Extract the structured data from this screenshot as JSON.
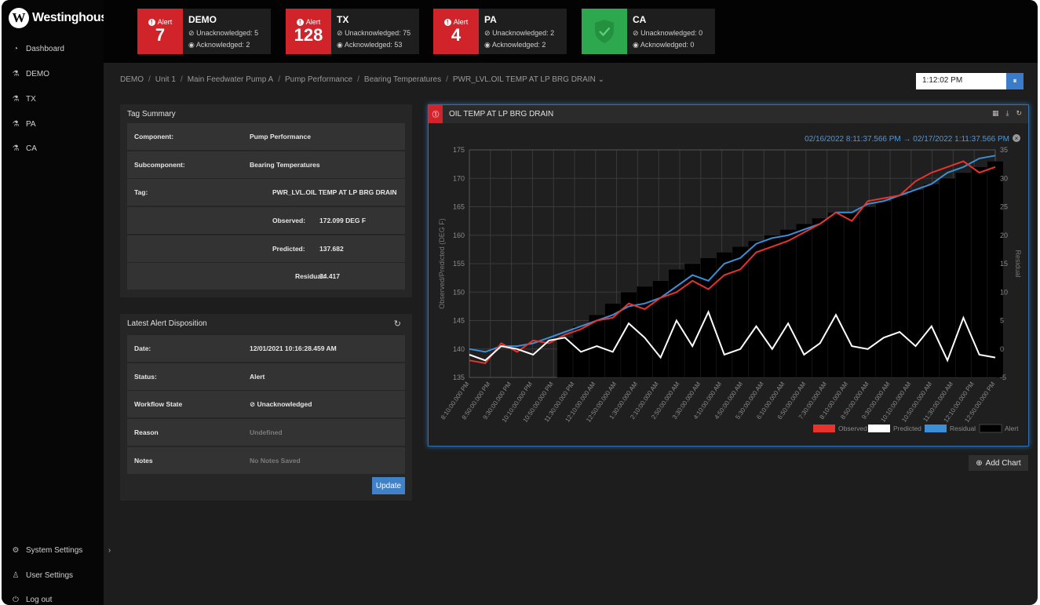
{
  "app": {
    "logo_text": "Westinghouse"
  },
  "sidebar": {
    "items": [
      {
        "label": "Dashboard",
        "icon": "gauge-icon"
      },
      {
        "label": "DEMO",
        "icon": "flask-icon"
      },
      {
        "label": "TX",
        "icon": "flask-icon"
      },
      {
        "label": "PA",
        "icon": "flask-icon"
      },
      {
        "label": "CA",
        "icon": "flask-icon"
      }
    ],
    "bottom": [
      {
        "label": "System Settings",
        "icon": "gear-icon"
      },
      {
        "label": "User Settings",
        "icon": "user-icon"
      },
      {
        "label": "Log out",
        "icon": "power-icon"
      }
    ]
  },
  "alerts": [
    {
      "site": "DEMO",
      "label": "Alert",
      "count": "7",
      "unack": "Unacknowledged: 5",
      "ack": "Acknowledged: 2",
      "status": "alert"
    },
    {
      "site": "TX",
      "label": "Alert",
      "count": "128",
      "unack": "Unacknowledged: 75",
      "ack": "Acknowledged: 53",
      "status": "alert"
    },
    {
      "site": "PA",
      "label": "Alert",
      "count": "4",
      "unack": "Unacknowledged: 2",
      "ack": "Acknowledged: 2",
      "status": "alert"
    },
    {
      "site": "CA",
      "label": "",
      "count": "",
      "unack": "Unacknowledged: 0",
      "ack": "Acknowledged: 0",
      "status": "ok"
    }
  ],
  "breadcrumb": [
    "DEMO",
    "Unit 1",
    "Main Feedwater Pump A",
    "Pump Performance",
    "Bearing Temperatures",
    "PWR_LVL.OIL TEMP AT LP BRG DRAIN"
  ],
  "time": {
    "value": "1:12:02 PM"
  },
  "tag_summary": {
    "title": "Tag Summary",
    "component_label": "Component:",
    "component": "Pump Performance",
    "subcomponent_label": "Subcomponent:",
    "subcomponent": "Bearing Temperatures",
    "tag_label": "Tag:",
    "tag": "PWR_LVL.OIL TEMP AT LP BRG DRAIN",
    "observed_label": "Observed:",
    "observed": "172.099 DEG F",
    "predicted_label": "Predicted:",
    "predicted": "137.682",
    "residual_label": "Residual:",
    "residual": "34.417"
  },
  "disposition": {
    "title": "Latest Alert Disposition",
    "date_label": "Date:",
    "date": "12/01/2021 10:16:28.459 AM",
    "status_label": "Status:",
    "status": "Alert",
    "workflow_label": "Workflow State",
    "workflow": "Unacknowledged",
    "reason_label": "Reason",
    "reason": "Undefined",
    "notes_label": "Notes",
    "notes": "No Notes Saved",
    "update_label": "Update"
  },
  "chart_panel": {
    "title": "OIL TEMP AT LP BRG DRAIN",
    "range": "02/16/2022 8:11:37.566 PM → 02/17/2022 1:11:37.566 PM",
    "add_chart_label": "Add Chart"
  },
  "colors": {
    "observed": "#e8332d",
    "predicted": "#ffffff",
    "residual": "#3a8fd6",
    "alert": "#000000",
    "alert_red": "#d1232a",
    "ok_green": "#2da84e",
    "accent": "#3f82c8"
  },
  "chart_data": {
    "type": "line",
    "ylabel": "Observed/Predicted (DEG F)",
    "y2label": "Residual",
    "ylim": [
      135,
      175
    ],
    "y2lim": [
      -5,
      35
    ],
    "yticks": [
      135,
      140,
      145,
      150,
      155,
      160,
      165,
      170,
      175
    ],
    "y2ticks": [
      -5,
      0,
      5,
      10,
      15,
      20,
      25,
      30,
      35
    ],
    "xticks": [
      "8:10:00.000 PM",
      "8:50:00.000 PM",
      "9:30:00.000 PM",
      "10:10:00.000 PM",
      "10:50:00.000 PM",
      "11:30:00.000 PM",
      "12:10:00.000 AM",
      "12:50:00.000 AM",
      "1:30:00.000 AM",
      "2:10:00.000 AM",
      "2:50:00.000 AM",
      "3:30:00.000 AM",
      "4:10:00.000 AM",
      "4:50:00.000 AM",
      "5:30:00.000 AM",
      "6:10:00.000 AM",
      "6:50:00.000 AM",
      "7:30:00.000 AM",
      "8:10:00.000 AM",
      "8:50:00.000 AM",
      "9:30:00.000 AM",
      "10:10:00.000 AM",
      "10:50:00.000 AM",
      "11:30:00.000 AM",
      "12:10:00.000 PM",
      "12:50:00.000 PM"
    ],
    "grid": true,
    "legend": "bottom-right",
    "series": [
      {
        "name": "Observed",
        "axis": "left",
        "values": [
          138,
          137.5,
          141,
          139.5,
          141.5,
          141,
          142.5,
          143.5,
          145,
          145.5,
          148,
          147,
          149,
          150,
          152,
          150.5,
          153,
          154,
          157,
          158,
          159,
          160.5,
          162,
          164,
          162.5,
          166,
          166.5,
          167,
          169.5,
          171,
          172,
          173,
          171,
          172
        ]
      },
      {
        "name": "Predicted",
        "axis": "left",
        "values": [
          139,
          138,
          140.5,
          140,
          139,
          141.5,
          142,
          139.5,
          140.5,
          139.5,
          144.5,
          142,
          138.5,
          145,
          140.5,
          146.5,
          139,
          140,
          144,
          140,
          144.5,
          139,
          141,
          146,
          140.5,
          140,
          142,
          143,
          140.5,
          144,
          138,
          145.5,
          139,
          138.5
        ]
      },
      {
        "name": "Residual",
        "axis": "left",
        "values": [
          140,
          139.5,
          140.5,
          140.5,
          141,
          142,
          143,
          144,
          145,
          146,
          147.5,
          148,
          149,
          151,
          153,
          152,
          155,
          156,
          158.5,
          159.5,
          160,
          161,
          162,
          164,
          164,
          165.5,
          166,
          167,
          168,
          169,
          171,
          172,
          173.5,
          174
        ]
      },
      {
        "name": "Alert",
        "axis": "right",
        "values": [
          0,
          0,
          0,
          0,
          0,
          0,
          2,
          4,
          6,
          8,
          10,
          11,
          12,
          14,
          15,
          16,
          17,
          18,
          19,
          20,
          21,
          22,
          23,
          24,
          24,
          25,
          26,
          27,
          28,
          29,
          30,
          31,
          32,
          33
        ]
      }
    ]
  }
}
